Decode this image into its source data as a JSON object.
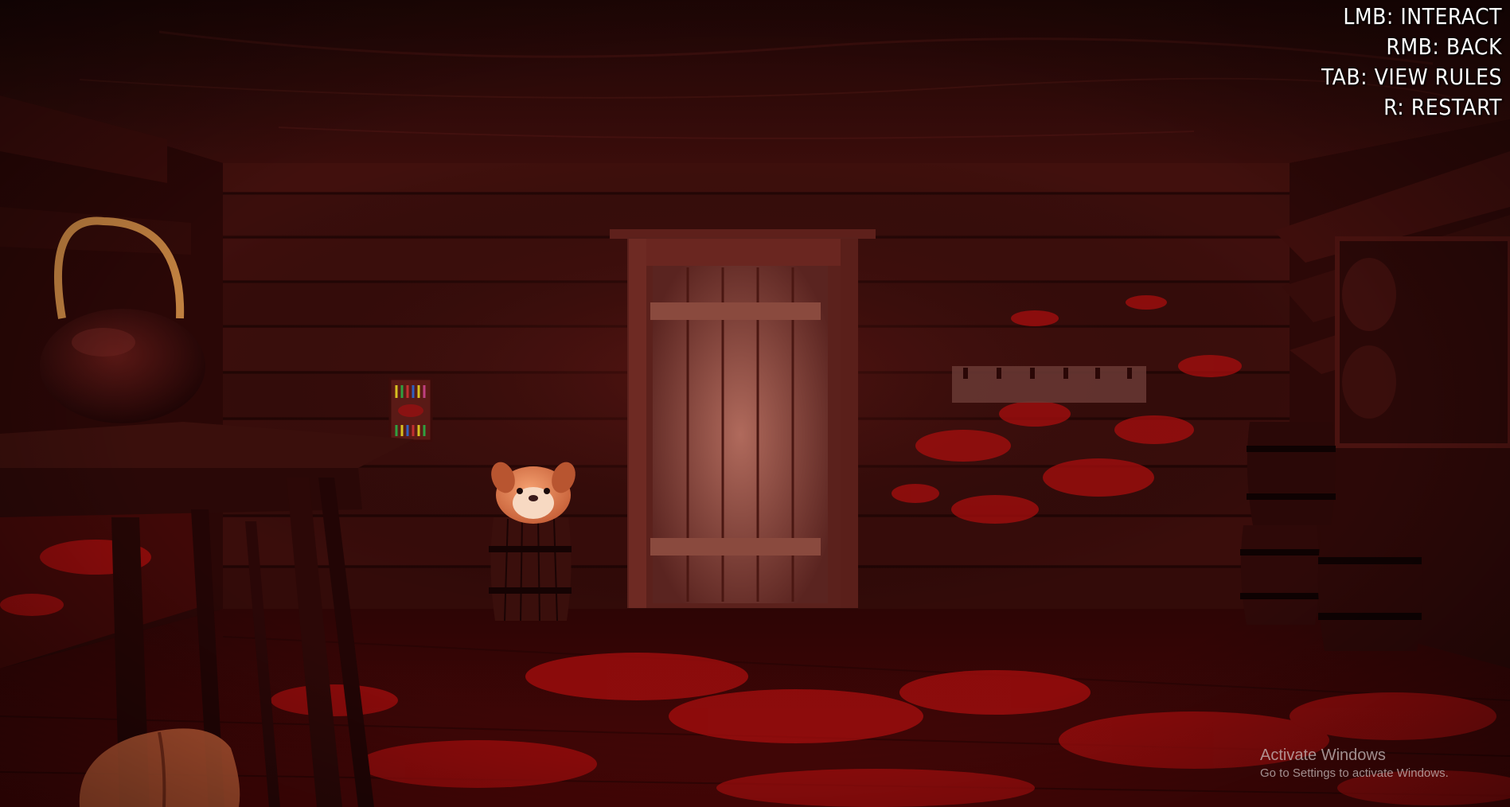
{
  "hud": {
    "controls": [
      "LMB: INTERACT",
      "RMB: BACK",
      "TAB: VIEW RULES",
      "R: RESTART"
    ]
  },
  "watermark": {
    "title": "Activate Windows",
    "subtitle": "Go to Settings to activate Windows."
  },
  "scene": {
    "tint_color": "#8a0d0d",
    "wall_color": "#3a0c0a",
    "ceiling_color": "#2a0807",
    "floor_color": "#3d0606",
    "blood_color": "#b00f0f",
    "door_color": "#7a3a30",
    "plush_color": "#e0814f"
  }
}
